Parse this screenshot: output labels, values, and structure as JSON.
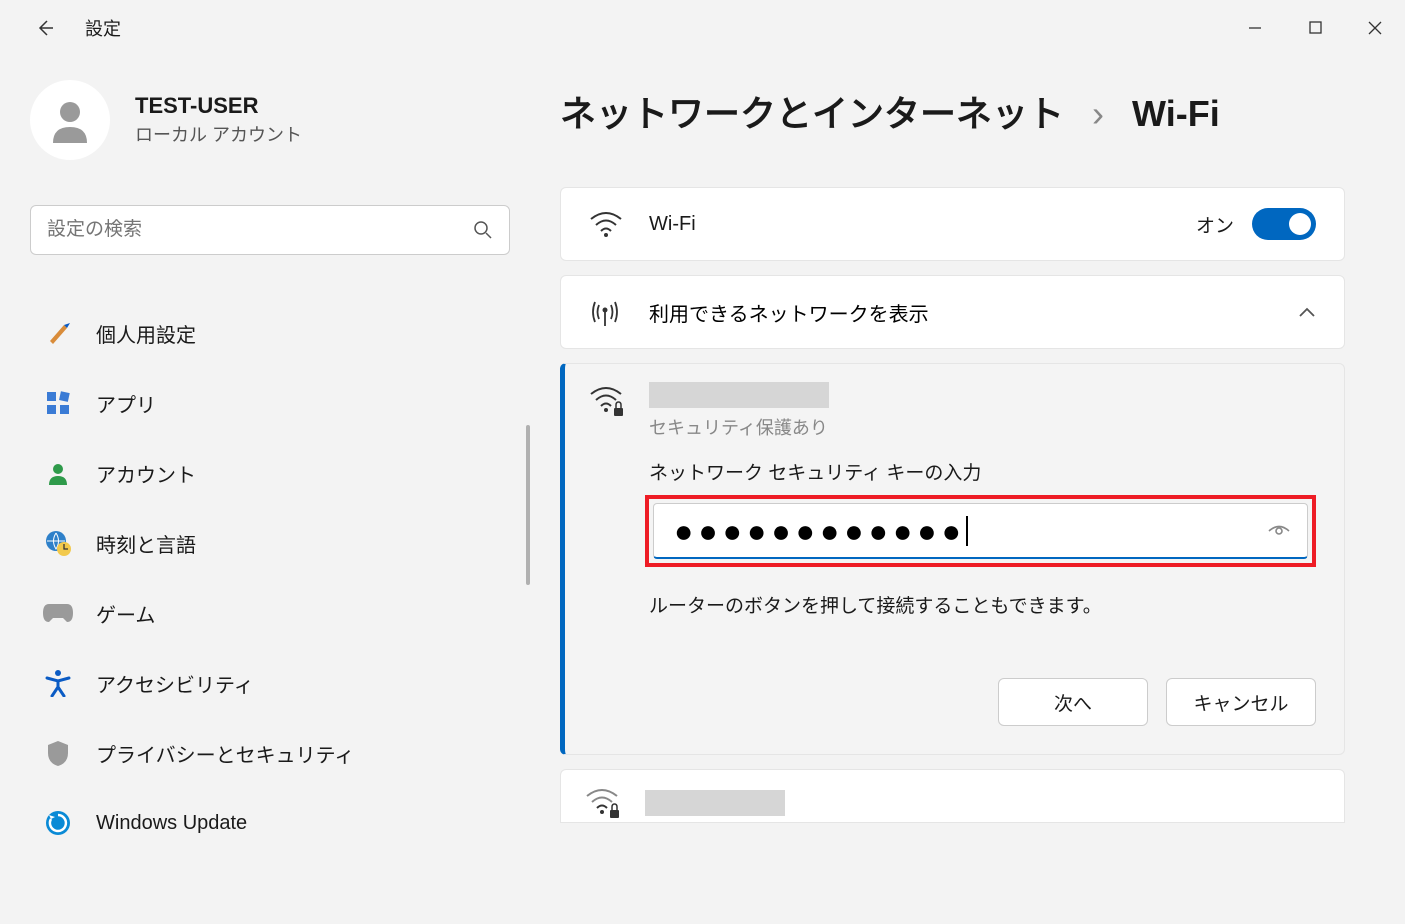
{
  "app_title": "設定",
  "window_controls": {
    "minimize": "−",
    "maximize": "□",
    "close": "✕"
  },
  "user": {
    "name": "TEST-USER",
    "type": "ローカル アカウント"
  },
  "search": {
    "placeholder": "設定の検索"
  },
  "sidebar": {
    "items": [
      {
        "label": "個人用設定",
        "icon": "brush"
      },
      {
        "label": "アプリ",
        "icon": "apps"
      },
      {
        "label": "アカウント",
        "icon": "account"
      },
      {
        "label": "時刻と言語",
        "icon": "time-language"
      },
      {
        "label": "ゲーム",
        "icon": "game"
      },
      {
        "label": "アクセシビリティ",
        "icon": "accessibility"
      },
      {
        "label": "プライバシーとセキュリティ",
        "icon": "privacy"
      },
      {
        "label": "Windows Update",
        "icon": "update"
      }
    ]
  },
  "breadcrumb": {
    "parent": "ネットワークとインターネット",
    "current": "Wi-Fi"
  },
  "wifi_card": {
    "label": "Wi-Fi",
    "state": "オン"
  },
  "available": {
    "label": "利用できるネットワークを表示"
  },
  "network": {
    "security": "セキュリティ保護あり",
    "prompt": "ネットワーク セキュリティ キーの入力",
    "password_mask": "●●●●●●●●●●●●",
    "hint": "ルーターのボタンを押して接続することもできます。",
    "next": "次へ",
    "cancel": "キャンセル"
  }
}
